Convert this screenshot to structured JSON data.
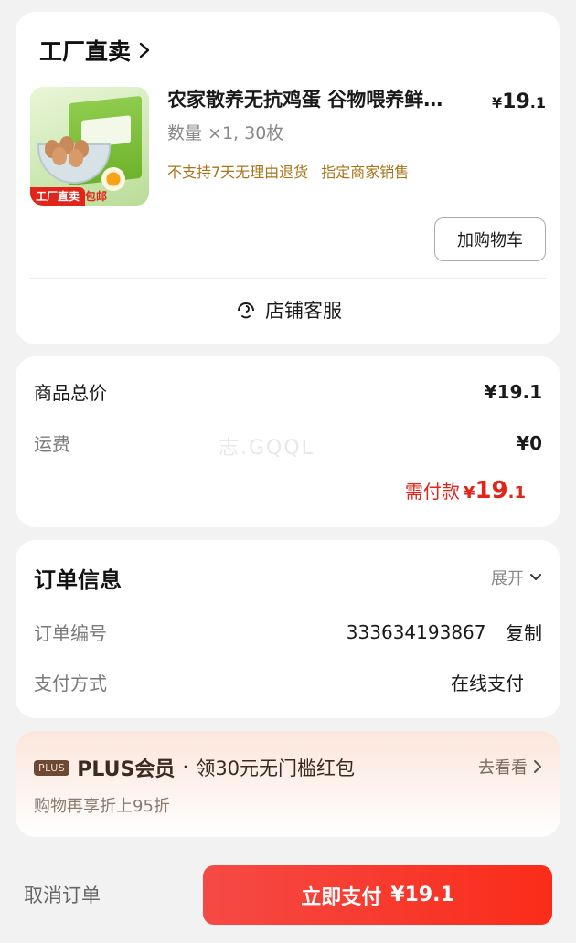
{
  "shop": {
    "name": "工厂直卖"
  },
  "product": {
    "title": "农家散养无抗鸡蛋 谷物喂养鲜…",
    "price_symbol": "¥",
    "price_int": "19",
    "price_dec": ".1",
    "quantity_text": "数量 ×1, 30枚",
    "tags": [
      "不支持7天无理由退货",
      "指定商家销售"
    ],
    "thumb_tags": {
      "factory": "工厂直卖",
      "shipping": "包邮"
    },
    "add_to_cart_label": "加购物车",
    "customer_service_label": "店铺客服"
  },
  "totals": {
    "goods_total_label": "商品总价",
    "goods_total_value": "¥19.1",
    "shipping_label": "运费",
    "shipping_value": "¥0",
    "watermark": "志.GQQL",
    "need_pay_label": "需付款",
    "need_pay_symbol": "¥",
    "need_pay_int": "19",
    "need_pay_dec": ".1"
  },
  "order_info": {
    "title": "订单信息",
    "expand_label": "展开",
    "order_no_label": "订单编号",
    "order_no_value": "333634193867",
    "copy_label": "复制",
    "pay_method_label": "支付方式",
    "pay_method_value": "在线支付"
  },
  "plus": {
    "badge": "PLUS",
    "name": "PLUS会员",
    "dot": "·",
    "offer": "领30元无门槛红包",
    "go_label": "去看看",
    "sub_text": "购物再享折上95折"
  },
  "bottom": {
    "cancel_label": "取消订单",
    "pay_label": "立即支付",
    "pay_amount": "¥19.1"
  },
  "colors": {
    "accent_red": "#e1251b",
    "tag_brown": "#a8741a",
    "page_bg": "#f2f2f2"
  }
}
